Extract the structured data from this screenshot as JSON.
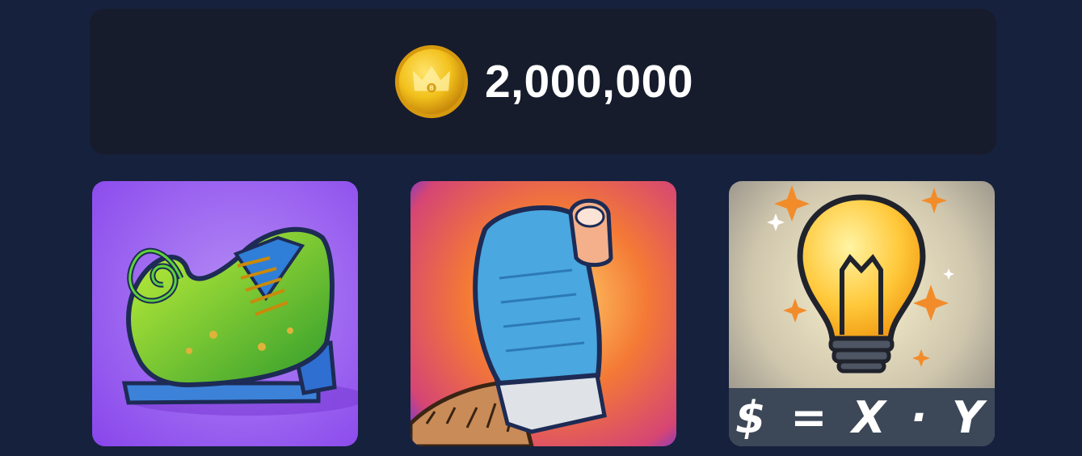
{
  "balance": {
    "icon": "coin-icon",
    "amount": "2,000,000",
    "coin_color": "#f2c11c"
  },
  "cards": [
    {
      "name": "shoe-card",
      "icon": "chameleon-shoe-image",
      "background": "#9a5cf0"
    },
    {
      "name": "sock-card",
      "icon": "toe-sock-image",
      "background": "#ef6f31"
    },
    {
      "name": "idea-card",
      "icon": "lightbulb-image",
      "background": "#c9c2ae",
      "formula": "$ = X · Y"
    }
  ]
}
